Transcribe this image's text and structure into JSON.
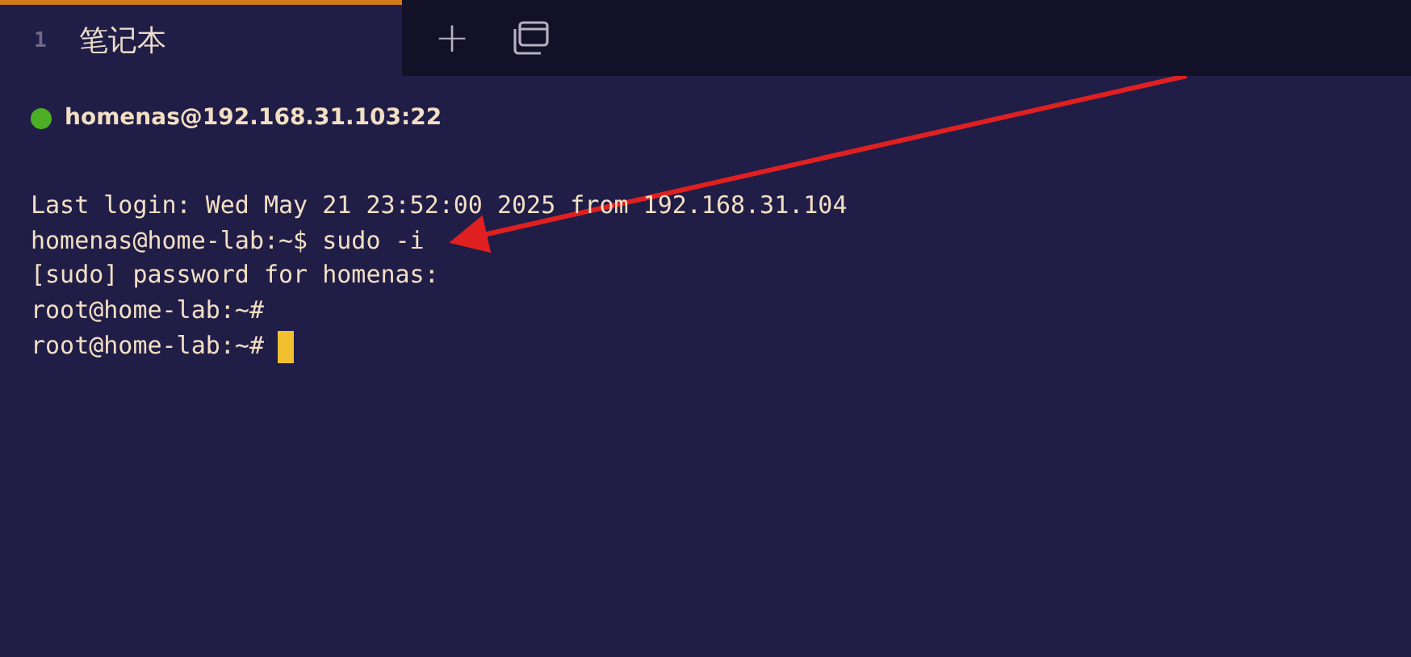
{
  "tabs": [
    {
      "index": "1",
      "label": "笔记本",
      "selected": true
    }
  ],
  "tab_actions": {
    "new_tab": "+"
  },
  "connection": {
    "connected": true,
    "host": "homenas@192.168.31.103:22"
  },
  "terminal": {
    "lines": [
      "Last login: Wed May 21 23:52:00 2025 from 192.168.31.104",
      "homenas@home-lab:~$ sudo -i",
      "[sudo] password for homenas:",
      "root@home-lab:~#",
      "root@home-lab:~#"
    ],
    "cursor": true
  }
}
